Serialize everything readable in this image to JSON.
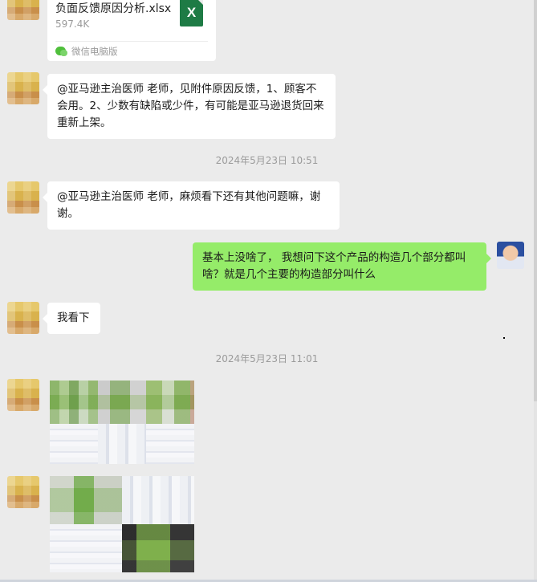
{
  "file_message": {
    "file_name": "负面反馈原因分析.xlsx",
    "file_size": "597.4K",
    "file_type_icon": "excel-icon",
    "source": "微信电脑版"
  },
  "messages": [
    {
      "sender": "contact",
      "text": "@亚马逊主治医师 老师，见附件原因反馈，1、顾客不会用。2、少数有缺陷或少件，有可能是亚马逊退货回来重新上架。"
    },
    {
      "sender": "contact",
      "text": "@亚马逊主治医师 老师，麻烦看下还有其他问题嘛，谢谢。"
    },
    {
      "sender": "me",
      "text": "基本上没啥了， 我想问下这个产品的构造几个部分都叫啥？就是几个主要的构造部分叫什么"
    },
    {
      "sender": "contact",
      "text": "我看下"
    }
  ],
  "timestamps": [
    "2024年5月23日 10:51",
    "2024年5月23日 11:01"
  ],
  "colors": {
    "background": "#ebebeb",
    "my_bubble": "#95ec69",
    "contact_bubble": "#ffffff",
    "excel_green": "#1e7b45",
    "timestamp_text": "#9b9b9b"
  }
}
